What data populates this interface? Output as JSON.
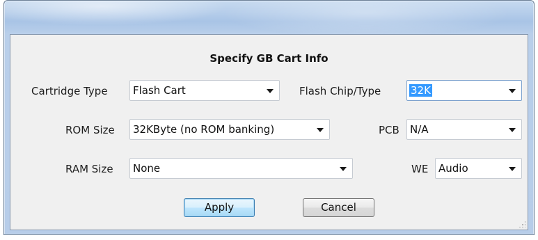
{
  "dialog": {
    "heading": "Specify GB Cart Info"
  },
  "fields": {
    "cartridge_type": {
      "label": "Cartridge Type",
      "value": "Flash Cart"
    },
    "flash_chip_type": {
      "label": "Flash Chip/Type",
      "value": "32K"
    },
    "rom_size": {
      "label": "ROM Size",
      "value": "32KByte (no ROM banking)"
    },
    "pcb": {
      "label": "PCB",
      "value": "N/A"
    },
    "ram_size": {
      "label": "RAM Size",
      "value": "None"
    },
    "we": {
      "label": "WE",
      "value": "Audio"
    }
  },
  "buttons": {
    "apply": "Apply",
    "cancel": "Cancel"
  },
  "icons": {
    "dropdown": "chevron-down-icon",
    "resize": "resize-grip-icon"
  },
  "colors": {
    "selection": "#3399ff",
    "default_button": "#bee6fd",
    "titlebar": "#a9c4e6"
  }
}
